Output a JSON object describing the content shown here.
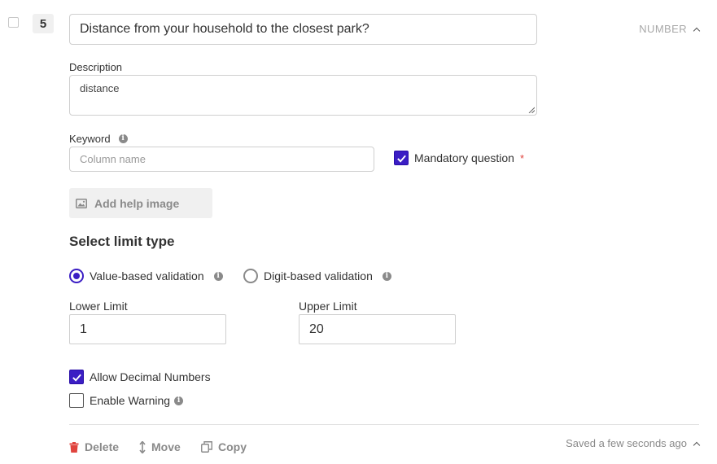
{
  "question": {
    "number": "5",
    "title": "Distance from your household to the closest park?",
    "type_label": "NUMBER"
  },
  "description": {
    "label": "Description",
    "value": "distance"
  },
  "keyword": {
    "label": "Keyword",
    "placeholder": "Column name",
    "value": ""
  },
  "mandatory": {
    "label": "Mandatory question",
    "required_mark": "*",
    "checked": true
  },
  "help_image": {
    "label": "Add help image"
  },
  "limit_type": {
    "title": "Select limit type",
    "options": [
      {
        "label": "Value-based validation",
        "selected": true
      },
      {
        "label": "Digit-based validation",
        "selected": false
      }
    ]
  },
  "limits": {
    "lower_label": "Lower Limit",
    "lower_value": "1",
    "upper_label": "Upper Limit",
    "upper_value": "20"
  },
  "options": {
    "allow_decimal": {
      "label": "Allow Decimal Numbers",
      "checked": true
    },
    "enable_warning": {
      "label": "Enable Warning",
      "checked": false
    }
  },
  "footer": {
    "delete_label": "Delete",
    "move_label": "Move",
    "copy_label": "Copy",
    "saved_text": "Saved a few seconds ago"
  },
  "colors": {
    "accent": "#3b1ec4",
    "required": "#e0443e",
    "muted": "#8a8a8a"
  }
}
